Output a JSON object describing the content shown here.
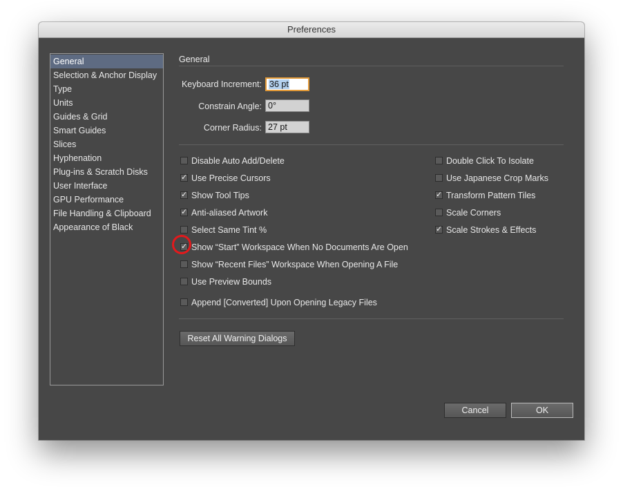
{
  "window": {
    "title": "Preferences"
  },
  "sidebar": {
    "items": [
      {
        "label": "General",
        "selected": true
      },
      {
        "label": "Selection & Anchor Display"
      },
      {
        "label": "Type"
      },
      {
        "label": "Units"
      },
      {
        "label": "Guides & Grid"
      },
      {
        "label": "Smart Guides"
      },
      {
        "label": "Slices"
      },
      {
        "label": "Hyphenation"
      },
      {
        "label": "Plug-ins & Scratch Disks"
      },
      {
        "label": "User Interface"
      },
      {
        "label": "GPU Performance"
      },
      {
        "label": "File Handling & Clipboard"
      },
      {
        "label": "Appearance of Black"
      }
    ]
  },
  "general": {
    "title": "General",
    "keyboard_increment": {
      "label": "Keyboard Increment:",
      "value": "36 pt"
    },
    "constrain_angle": {
      "label": "Constrain Angle:",
      "value": "0°"
    },
    "corner_radius": {
      "label": "Corner Radius:",
      "value": "27 pt"
    }
  },
  "options_left": [
    {
      "label": "Disable Auto Add/Delete",
      "checked": false
    },
    {
      "label": "Use Precise Cursors",
      "checked": true
    },
    {
      "label": "Show Tool Tips",
      "checked": true
    },
    {
      "label": "Anti-aliased Artwork",
      "checked": true
    },
    {
      "label": "Select Same Tint %",
      "checked": false
    },
    {
      "label": "Show “Start” Workspace When No Documents Are Open",
      "checked": true
    },
    {
      "label": "Show “Recent Files” Workspace When Opening A File",
      "checked": false
    },
    {
      "label": "Use Preview Bounds",
      "checked": false
    },
    {
      "label": "Append [Converted] Upon Opening Legacy Files",
      "checked": false
    }
  ],
  "options_right": [
    {
      "label": "Double Click To Isolate",
      "checked": false
    },
    {
      "label": "Use Japanese Crop Marks",
      "checked": false
    },
    {
      "label": "Transform Pattern Tiles",
      "checked": true
    },
    {
      "label": "Scale Corners",
      "checked": false
    },
    {
      "label": "Scale Strokes & Effects",
      "checked": true
    }
  ],
  "buttons": {
    "reset_warnings": "Reset All Warning Dialogs",
    "cancel": "Cancel",
    "ok": "OK"
  },
  "check_glyph": "✓",
  "colors": {
    "annotation": "#e4191c",
    "selection": "#5e6b82",
    "focus": "#e29a39"
  }
}
